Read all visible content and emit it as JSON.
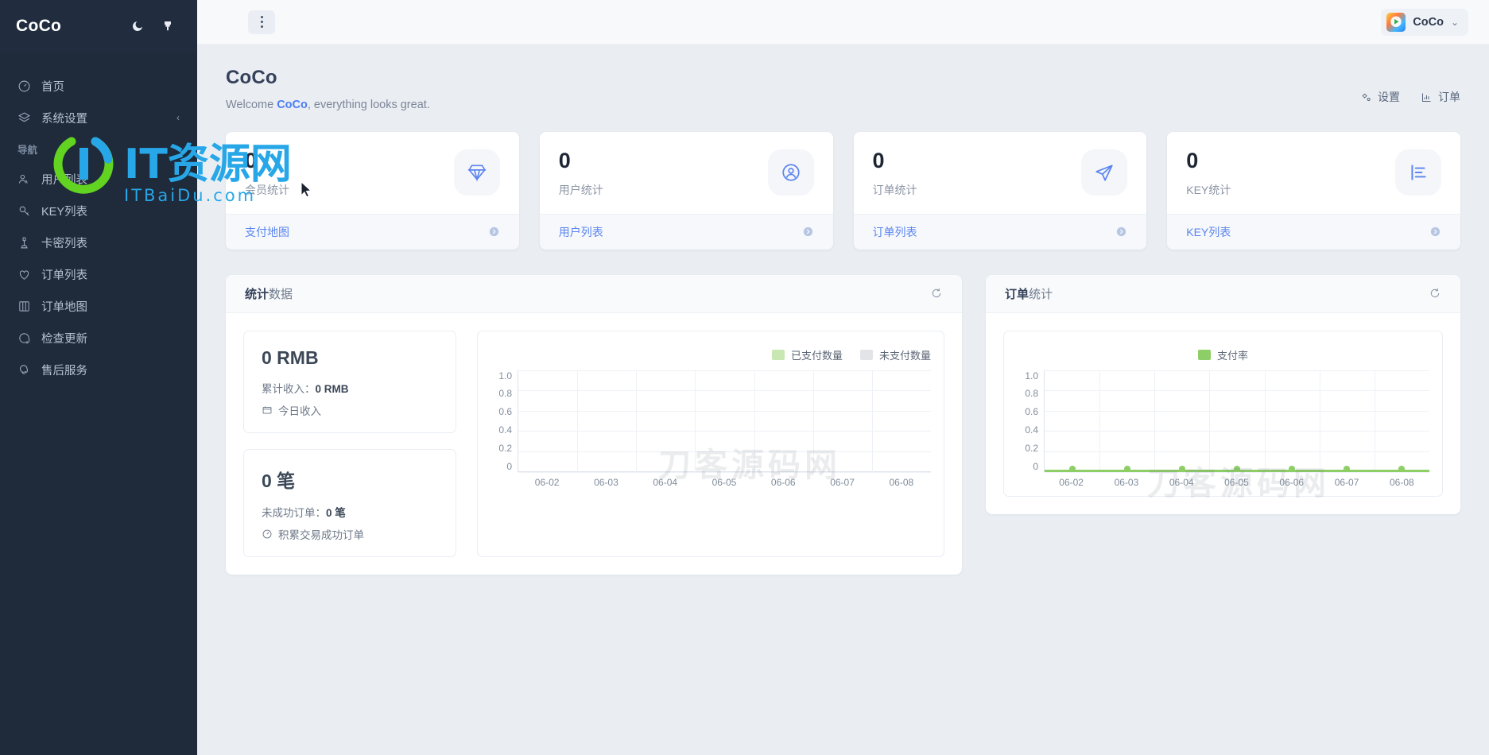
{
  "sidebar": {
    "logo": "CoCo",
    "theme_toggle_icon": "moon-icon",
    "skin_icon": "paint-brush-icon",
    "items": [
      {
        "label": "首页",
        "icon": "dashboard-icon"
      },
      {
        "label": "系统设置",
        "icon": "layers-icon",
        "caret": "‹"
      }
    ],
    "group_title": "导航",
    "nav_items": [
      {
        "label": "用户列表",
        "icon": "users-icon"
      },
      {
        "label": "KEY列表",
        "icon": "key-icon"
      },
      {
        "label": "卡密列表",
        "icon": "card-icon"
      },
      {
        "label": "订单列表",
        "icon": "heart-icon"
      },
      {
        "label": "订单地图",
        "icon": "book-icon"
      },
      {
        "label": "检查更新",
        "icon": "message-icon"
      },
      {
        "label": "售后服务",
        "icon": "support-icon"
      }
    ]
  },
  "topbar": {
    "menu_icon": "kebab-menu-icon",
    "user_name": "CoCo",
    "user_chevron": "⌄",
    "avatar_icon": "tencent-video-avatar"
  },
  "page": {
    "title": "CoCo",
    "welcome_prefix": "Welcome ",
    "welcome_user": "CoCo",
    "welcome_suffix": ", everything looks great.",
    "actions": [
      {
        "label": "设置",
        "icon": "gear-icon"
      },
      {
        "label": "订单",
        "icon": "bar-chart-icon"
      }
    ]
  },
  "stat_cards": [
    {
      "value": "0",
      "label": "会员统计",
      "icon": "diamond-icon",
      "link": "支付地图",
      "arrow": "arrow-right-circle-icon"
    },
    {
      "value": "0",
      "label": "用户统计",
      "icon": "user-circle-icon",
      "link": "用户列表",
      "arrow": "arrow-right-circle-icon"
    },
    {
      "value": "0",
      "label": "订单统计",
      "icon": "paper-plane-icon",
      "link": "订单列表",
      "arrow": "arrow-right-circle-icon"
    },
    {
      "value": "0",
      "label": "KEY统计",
      "icon": "bar-chart-icon",
      "link": "KEY列表",
      "arrow": "arrow-right-circle-icon"
    }
  ],
  "left_panel": {
    "title_bold": "统计",
    "title_light": "数据",
    "refresh_icon": "refresh-icon",
    "mini_cards": [
      {
        "value": "0 RMB",
        "sub_label": "累计收入：",
        "sub_value": "0 RMB",
        "foot_label": "今日收入",
        "foot_icon": "calendar-icon"
      },
      {
        "value": "0 笔",
        "sub_label": "未成功订单：",
        "sub_value": "0 笔",
        "foot_label": "积累交易成功订单",
        "foot_icon": "clock-icon"
      }
    ]
  },
  "right_panel": {
    "title_bold": "订单",
    "title_light": "统计",
    "refresh_icon": "refresh-icon"
  },
  "colors": {
    "brand_blue": "#4a7cf3",
    "sidebar_bg": "#1f2a3a",
    "paid_green": "#c9e7b3",
    "unpaid_gray": "#e2e4e8",
    "line_green": "#8ece66"
  },
  "chart_data": [
    {
      "type": "bar",
      "title": "统计数据",
      "categories": [
        "06-02",
        "06-03",
        "06-04",
        "06-05",
        "06-06",
        "06-07",
        "06-08"
      ],
      "series": [
        {
          "name": "已支付数量",
          "color": "#c9e7b3",
          "values": [
            0,
            0,
            0,
            0,
            0,
            0,
            0
          ]
        },
        {
          "name": "未支付数量",
          "color": "#e2e4e8",
          "values": [
            0,
            0,
            0,
            0,
            0,
            0,
            0
          ]
        }
      ],
      "yticks": [
        "1.0",
        "0.8",
        "0.6",
        "0.4",
        "0.2",
        "0"
      ],
      "ylim": [
        0,
        1
      ],
      "xlabel": "",
      "ylabel": "",
      "grid": true,
      "legend_position": "top-right"
    },
    {
      "type": "line",
      "title": "订单统计",
      "categories": [
        "06-02",
        "06-03",
        "06-04",
        "06-05",
        "06-06",
        "06-07",
        "06-08"
      ],
      "series": [
        {
          "name": "支付率",
          "color": "#8ece66",
          "values": [
            0,
            0,
            0,
            0,
            0,
            0,
            0
          ]
        }
      ],
      "yticks": [
        "1.0",
        "0.8",
        "0.6",
        "0.4",
        "0.2",
        "0"
      ],
      "ylim": [
        0,
        1
      ],
      "xlabel": "",
      "ylabel": "",
      "grid": true,
      "legend_position": "top-center"
    }
  ],
  "watermarks": {
    "it_logo_text": "IT资源网",
    "it_logo_sub": "ITBaiDu.com",
    "dk_text_1": "刀客源码网",
    "dk_text_2": "刀客源码网"
  }
}
